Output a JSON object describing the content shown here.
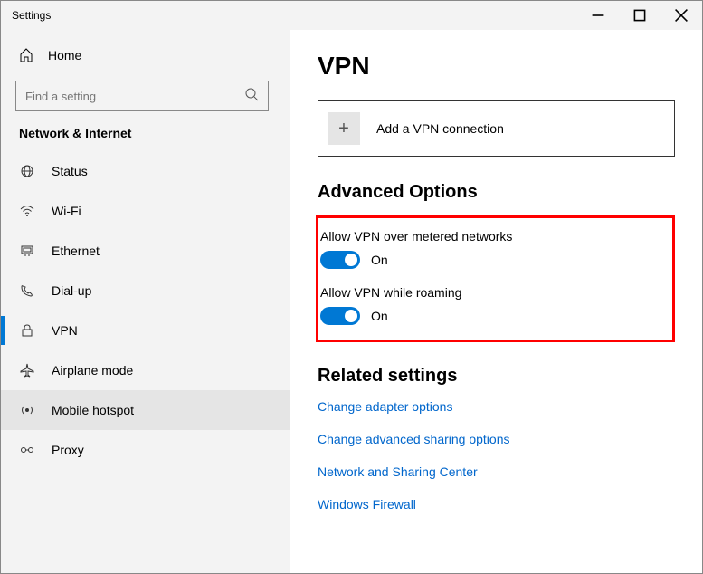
{
  "window": {
    "title": "Settings"
  },
  "sidebar": {
    "home": "Home",
    "search_placeholder": "Find a setting",
    "category": "Network & Internet",
    "items": [
      {
        "label": "Status"
      },
      {
        "label": "Wi-Fi"
      },
      {
        "label": "Ethernet"
      },
      {
        "label": "Dial-up"
      },
      {
        "label": "VPN"
      },
      {
        "label": "Airplane mode"
      },
      {
        "label": "Mobile hotspot"
      },
      {
        "label": "Proxy"
      }
    ]
  },
  "main": {
    "title": "VPN",
    "add_label": "Add a VPN connection",
    "advanced_title": "Advanced Options",
    "opt1_label": "Allow VPN over metered networks",
    "opt1_state": "On",
    "opt2_label": "Allow VPN while roaming",
    "opt2_state": "On",
    "related_title": "Related settings",
    "links": [
      "Change adapter options",
      "Change advanced sharing options",
      "Network and Sharing Center",
      "Windows Firewall"
    ]
  }
}
